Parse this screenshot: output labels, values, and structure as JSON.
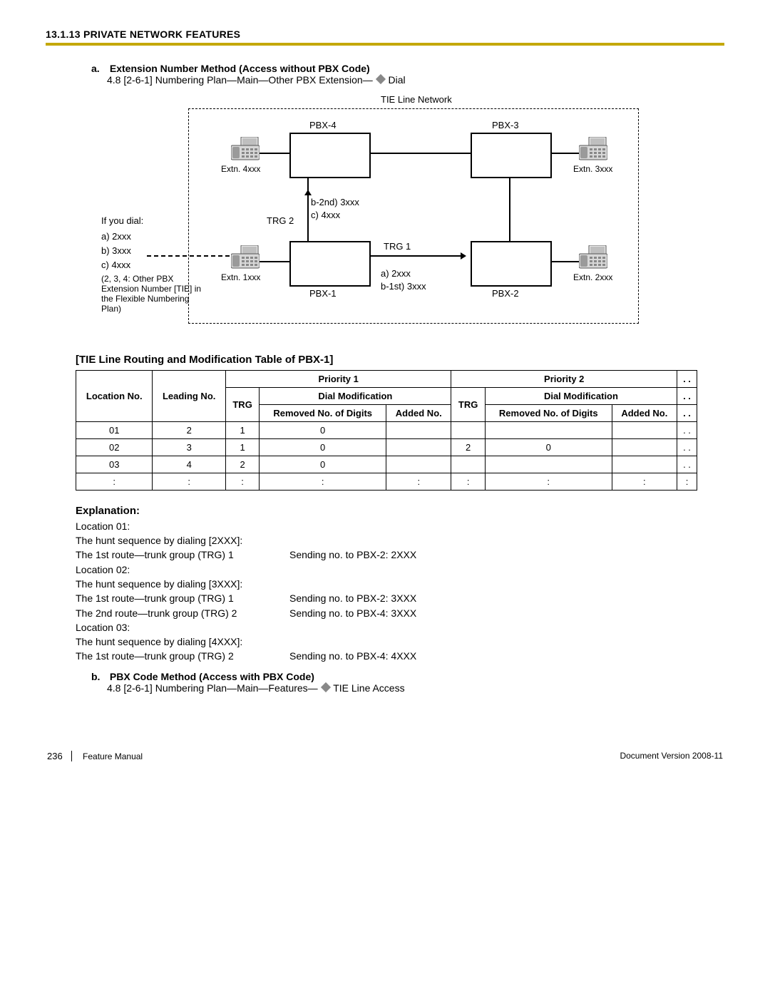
{
  "header": {
    "section": "13.1.13 PRIVATE NETWORK FEATURES"
  },
  "item_a": {
    "label": "a.",
    "title": "Extension Number Method (Access without PBX Code)",
    "body_prefix": "4.8  [2-6-1] Numbering Plan—Main—Other PBX Extension—",
    "body_suffix": " Dial"
  },
  "diagram": {
    "title": "TIE Line Network",
    "pbx1": "PBX-1",
    "pbx2": "PBX-2",
    "pbx3": "PBX-3",
    "pbx4": "PBX-4",
    "ext1": "Extn. 1xxx",
    "ext2": "Extn. 2xxx",
    "ext3": "Extn. 3xxx",
    "ext4": "Extn. 4xxx",
    "ifdial": "If you dial:",
    "opt_a": "a) 2xxx",
    "opt_b": "b) 3xxx",
    "opt_c": "c) 4xxx",
    "note": "(2, 3, 4: Other PBX Extension Number [TIE] in the Flexible Numbering Plan)",
    "trg1": "TRG 1",
    "trg2": "TRG 2",
    "b2nd": "b-2nd) 3xxx",
    "c4": "c) 4xxx",
    "a2": "a) 2xxx",
    "b1st": "b-1st) 3xxx"
  },
  "table_title": "[TIE Line Routing and Modification Table of PBX-1]",
  "table": {
    "hdr_loc": "Location No.",
    "hdr_lead": "Leading No.",
    "hdr_p1": "Priority 1",
    "hdr_p2": "Priority 2",
    "hdr_trg": "TRG",
    "hdr_mod": "Dial Modification",
    "hdr_rem": "Removed No. of Digits",
    "hdr_add": "Added No.",
    "dots": ". .",
    "rows": [
      {
        "loc": "01",
        "lead": "2",
        "p1": {
          "trg": "1",
          "rem": "0",
          "add": ""
        },
        "p2": {
          "trg": "",
          "rem": "",
          "add": ""
        }
      },
      {
        "loc": "02",
        "lead": "3",
        "p1": {
          "trg": "1",
          "rem": "0",
          "add": ""
        },
        "p2": {
          "trg": "2",
          "rem": "0",
          "add": ""
        }
      },
      {
        "loc": "03",
        "lead": "4",
        "p1": {
          "trg": "2",
          "rem": "0",
          "add": ""
        },
        "p2": {
          "trg": "",
          "rem": "",
          "add": ""
        }
      },
      {
        "loc": ":",
        "lead": ":",
        "p1": {
          "trg": ":",
          "rem": ":",
          "add": ":"
        },
        "p2": {
          "trg": ":",
          "rem": ":",
          "add": ":"
        }
      }
    ]
  },
  "expl": {
    "hdr": "Explanation:",
    "loc01": "Location 01:",
    "loc01_hunt": "The hunt sequence by dialing [2XXX]:",
    "loc01_r1a": "The 1st route—trunk group (TRG) 1",
    "loc01_r1b": "Sending no. to PBX-2: 2XXX",
    "loc02": "Location 02:",
    "loc02_hunt": "The hunt sequence by dialing [3XXX]:",
    "loc02_r1a": "The 1st route—trunk group (TRG) 1",
    "loc02_r1b": "Sending no. to PBX-2: 3XXX",
    "loc02_r2a": "The 2nd route—trunk group (TRG) 2",
    "loc02_r2b": "Sending no. to PBX-4: 3XXX",
    "loc03": "Location 03:",
    "loc03_hunt": "The hunt sequence by dialing [4XXX]:",
    "loc03_r1a": "The 1st route—trunk group (TRG) 2",
    "loc03_r1b": "Sending no. to PBX-4: 4XXX"
  },
  "item_b": {
    "label": "b.",
    "title": "PBX Code Method (Access with PBX Code)",
    "body_prefix": "4.8  [2-6-1] Numbering Plan—Main—Features—",
    "body_suffix": " TIE Line Access"
  },
  "footer": {
    "page": "236",
    "manual": "Feature Manual",
    "version": "Document Version  2008-11"
  }
}
